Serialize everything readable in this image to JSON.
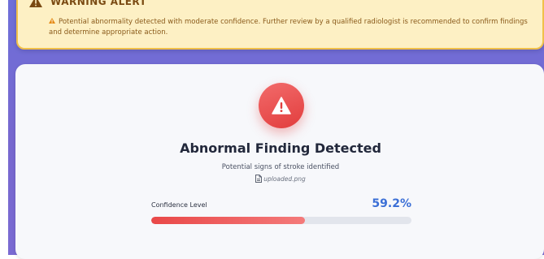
{
  "alert": {
    "title": "WARNING ALERT",
    "icon": "warning-triangle-icon",
    "message_icon": "warning-triangle-icon",
    "message": "Potential abnormality detected with moderate confidence. Further review by a qualified radiologist is recommended to confirm findings and determine appropriate action."
  },
  "result": {
    "icon": "warning-triangle-icon",
    "headline": "Abnormal Finding Detected",
    "subline": "Potential signs of stroke identified",
    "file_icon": "file-icon",
    "filename": "uploaded.png"
  },
  "confidence": {
    "label": "Confidence Level",
    "value_text": "59.2%",
    "fraction": 0.592
  },
  "colors": {
    "alert_bg": "#fdf0c4",
    "alert_border": "#f0c04a",
    "danger": "#e23d3d",
    "accent_blue": "#3b6fd6",
    "background_purple": "#7768cf"
  }
}
